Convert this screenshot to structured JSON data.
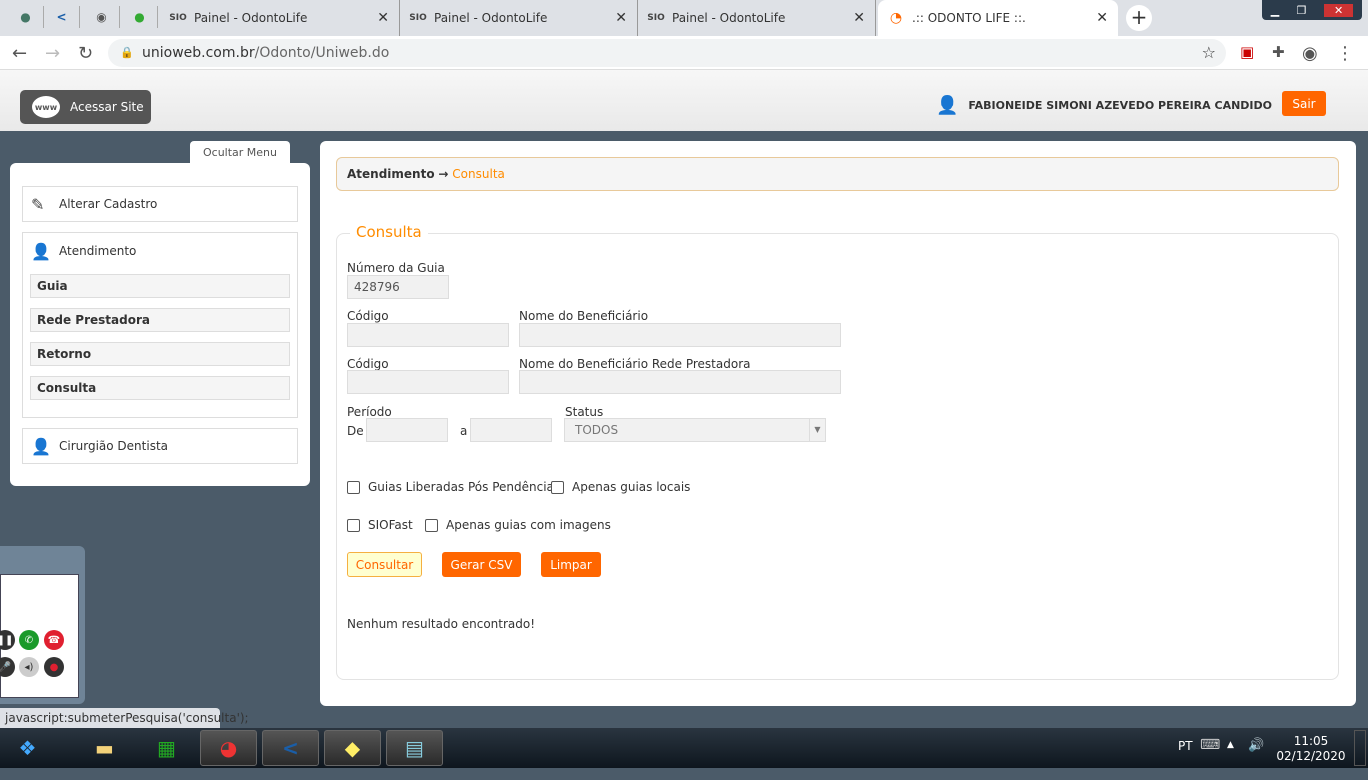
{
  "browser": {
    "tabs": [
      {
        "title": "Painel - OdontoLife"
      },
      {
        "title": "Painel - OdontoLife"
      },
      {
        "title": "Painel - OdontoLife"
      },
      {
        "title": ".:: ODONTO LIFE ::."
      }
    ],
    "url_host": "unioweb.com.br",
    "url_path": "/Odonto/Uniweb.do"
  },
  "header": {
    "site_button": "Acessar Site",
    "www": "www",
    "user_name": "FABIONEIDE SIMONI AZEVEDO PEREIRA CANDIDO",
    "logout": "Sair"
  },
  "sidebar": {
    "toggle": "Ocultar Menu",
    "alter": "Alterar Cadastro",
    "atendimento": "Atendimento",
    "items": [
      "Guia",
      "Rede Prestadora",
      "Retorno",
      "Consulta"
    ],
    "cirurgiao": "Cirurgião Dentista"
  },
  "breadcrumb": {
    "parent": "Atendimento",
    "arrow": "→",
    "current": "Consulta"
  },
  "form": {
    "legend": "Consulta",
    "numero_label": "Número da Guia",
    "numero_value": "428796",
    "codigo_label": "Código",
    "benef_label": "Nome do Beneficiário",
    "codigo2_label": "Código",
    "benef_rede_label": "Nome do Beneficiário Rede Prestadora",
    "periodo_label": "Período",
    "de": "De",
    "a": "a",
    "status_label": "Status",
    "status_value": "TODOS",
    "cb1": "Guias Liberadas Pós Pendência",
    "cb2": "Apenas guias locais",
    "cb3": "SIOFast",
    "cb4": "Apenas guias com imagens",
    "btn_consultar": "Consultar",
    "btn_csv": "Gerar CSV",
    "btn_limpar": "Limpar",
    "result": "Nenhum resultado encontrado!"
  },
  "statusbar": "javascript:submeterPesquisa('consulta');",
  "taskbar": {
    "lang": "PT",
    "time": "11:05",
    "date": "02/12/2020"
  },
  "colors": {
    "accent": "#ff6600",
    "bg": "#4b5b69"
  }
}
